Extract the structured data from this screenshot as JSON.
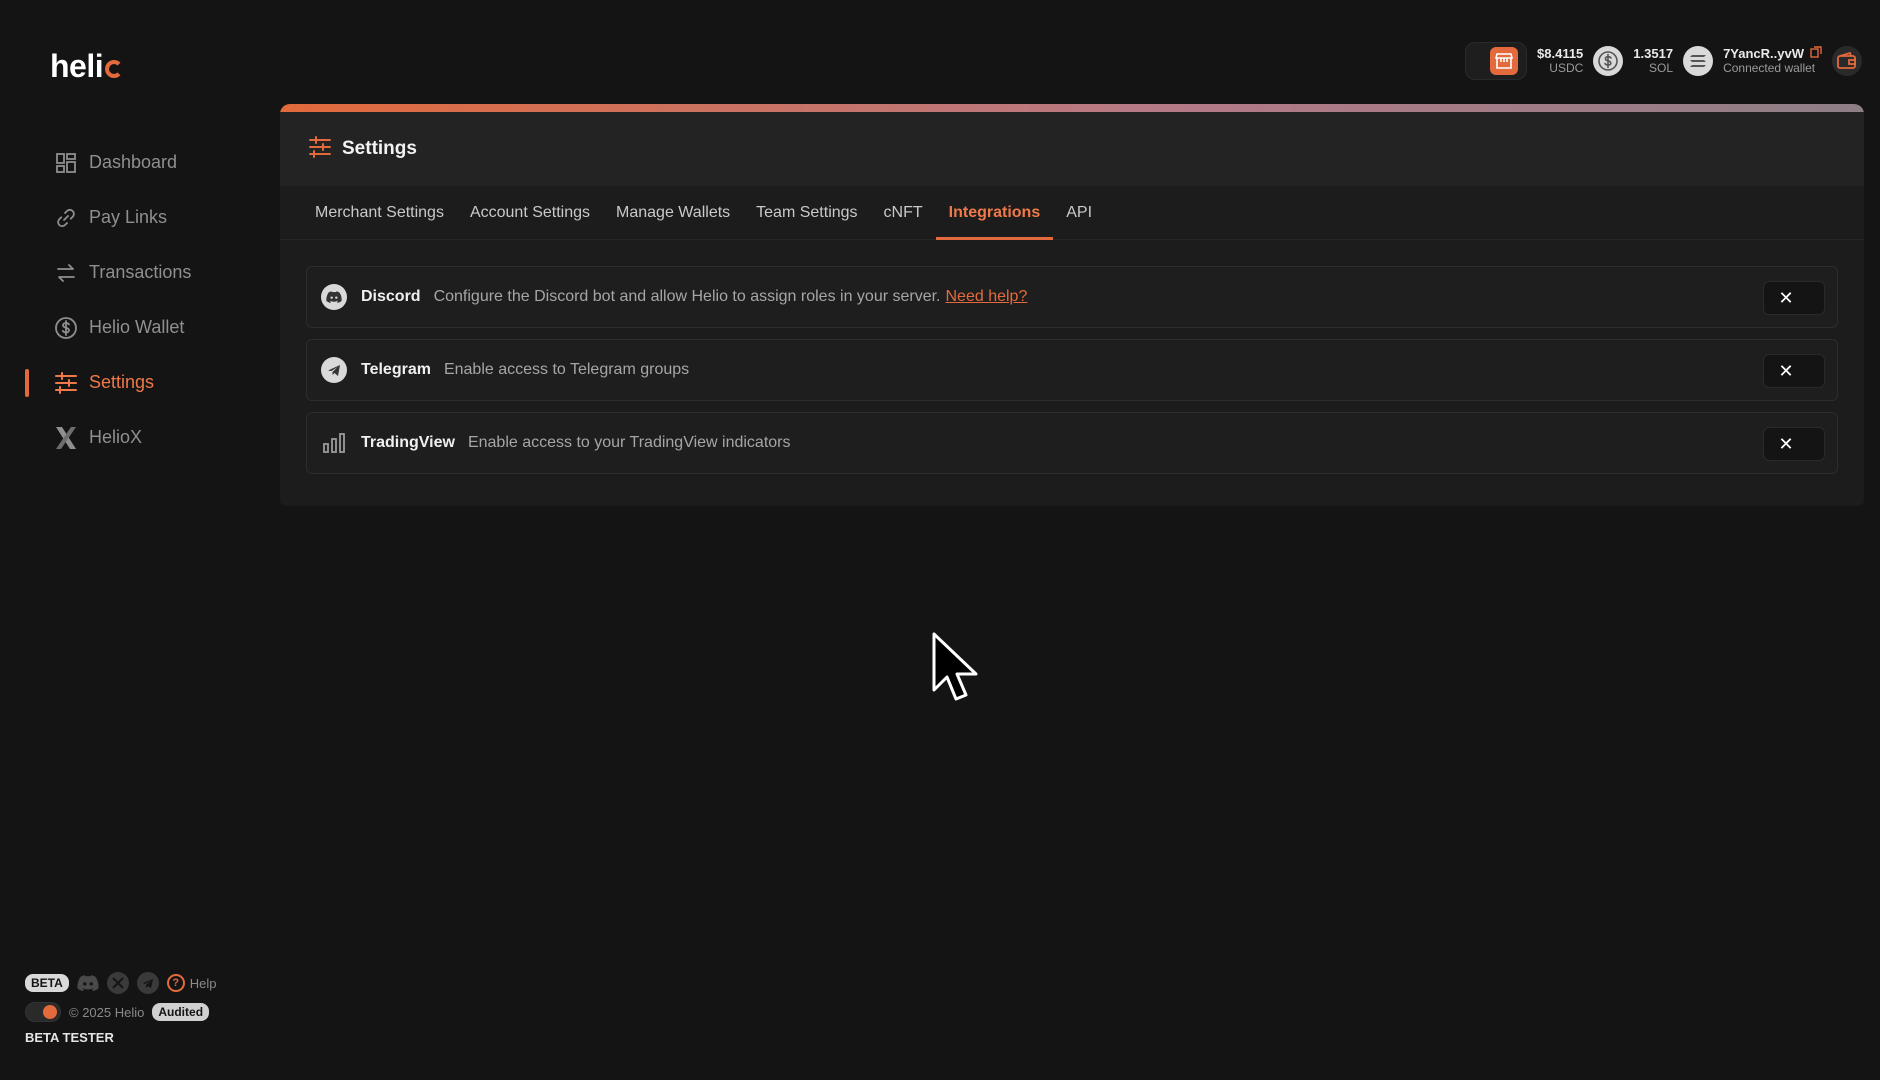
{
  "brand": {
    "logo_text": "heli",
    "accent_color": "#e26a3c"
  },
  "sidebar": {
    "items": [
      {
        "label": "Dashboard",
        "icon": "dashboard-icon",
        "active": false
      },
      {
        "label": "Pay Links",
        "icon": "link-icon",
        "active": false
      },
      {
        "label": "Transactions",
        "icon": "transfer-arrows-icon",
        "active": false
      },
      {
        "label": "Helio Wallet",
        "icon": "dollar-circle-icon",
        "active": false
      },
      {
        "label": "Settings",
        "icon": "sliders-icon",
        "active": true
      },
      {
        "label": "HelioX",
        "icon": "x-logo-icon",
        "active": false
      }
    ],
    "footer": {
      "beta_badge": "BETA",
      "help_label": "Help",
      "copyright": "© 2025 Helio",
      "audited_badge": "Audited",
      "role_label": "BETA TESTER"
    }
  },
  "topbar": {
    "usdc_value": "$8.4115",
    "usdc_unit": "USDC",
    "sol_value": "1.3517",
    "sol_unit": "SOL",
    "wallet_address": "7YancR..yvW",
    "wallet_status": "Connected wallet"
  },
  "settings": {
    "title": "Settings",
    "tabs": [
      {
        "label": "Merchant Settings",
        "active": false
      },
      {
        "label": "Account Settings",
        "active": false
      },
      {
        "label": "Manage Wallets",
        "active": false
      },
      {
        "label": "Team Settings",
        "active": false
      },
      {
        "label": "cNFT",
        "active": false
      },
      {
        "label": "Integrations",
        "active": true
      },
      {
        "label": "API",
        "active": false
      }
    ],
    "integrations": [
      {
        "name": "Discord",
        "description": "Configure the Discord bot and allow Helio to assign roles in your server.",
        "link": "Need help?",
        "icon": "discord-icon",
        "enabled": false
      },
      {
        "name": "Telegram",
        "description": "Enable access to Telegram groups",
        "icon": "telegram-icon",
        "enabled": false
      },
      {
        "name": "TradingView",
        "description": "Enable access to your TradingView indicators",
        "icon": "bar-chart-icon",
        "enabled": false
      }
    ]
  }
}
